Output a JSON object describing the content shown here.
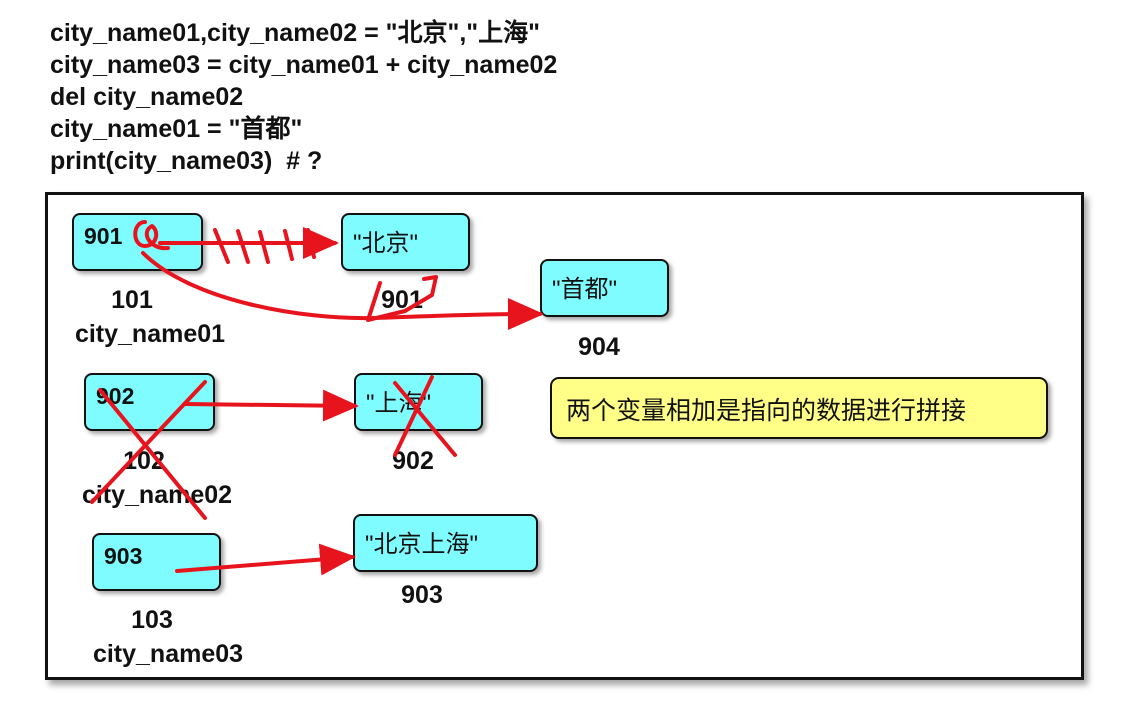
{
  "code": {
    "lines": [
      "city_name01,city_name02 = \"北京\",\"上海\"",
      "city_name03 = city_name01 + city_name02",
      "del city_name02",
      "city_name01 = \"首都\"",
      "print(city_name03)  # ?"
    ]
  },
  "variables": [
    {
      "address": "101",
      "name": "city_name01",
      "ref": "901"
    },
    {
      "address": "102",
      "name": "city_name02",
      "ref": "902"
    },
    {
      "address": "103",
      "name": "city_name03",
      "ref": "903"
    }
  ],
  "objects": [
    {
      "address": "901",
      "value": "\"北京\""
    },
    {
      "address": "902",
      "value": "\"上海\""
    },
    {
      "address": "903",
      "value": "\"北京上海\""
    },
    {
      "address": "904",
      "value": "\"首都\""
    }
  ],
  "note": "两个变量相加是指向的数据进行拼接",
  "colors": {
    "box_fill": "#7ffcff",
    "note_fill": "#ffff88",
    "annotation": "#e8141d"
  }
}
